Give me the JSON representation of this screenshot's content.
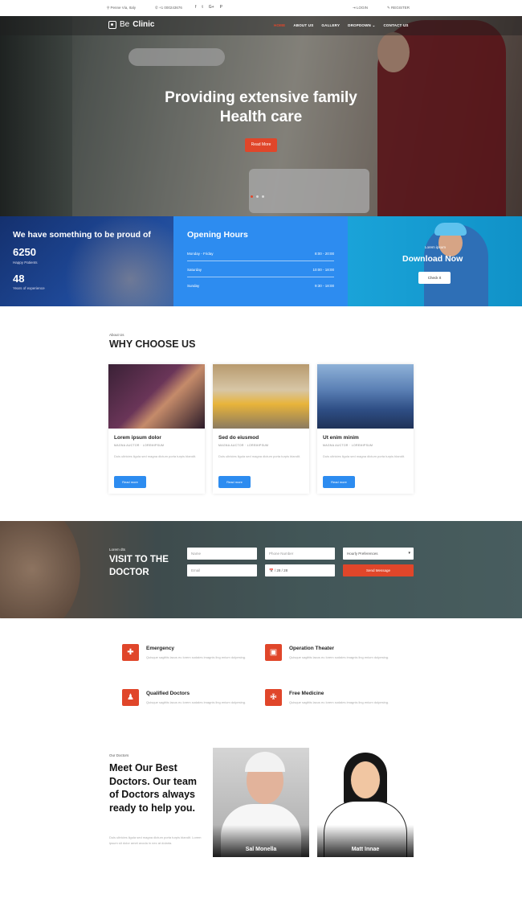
{
  "topbar": {
    "location": "Penne Via, Italy",
    "phone": "+1 000243676",
    "social": [
      "f",
      "t",
      "G+",
      "P"
    ],
    "login": "LOGIN",
    "register": "REGISTER"
  },
  "brand": {
    "part1": "Be",
    "part2": "Clinic"
  },
  "nav": [
    "HOME",
    "ABOUT US",
    "GALLERY",
    "DROPDOWN ⌄",
    "CONTACT US"
  ],
  "hero": {
    "title_line1": "Providing extensive family",
    "title_line2": "Health care",
    "button": "Read More"
  },
  "proud": {
    "title": "We have something to be proud of",
    "stat1_value": "6250",
    "stat1_label": "Happy Patients",
    "stat2_value": "48",
    "stat2_label": "Years of experience"
  },
  "hours": {
    "title": "Opening Hours",
    "rows": [
      {
        "day": "Monday - Friday",
        "time": "8:00 - 20:00"
      },
      {
        "day": "Saturday",
        "time": "10:00 - 18:00"
      },
      {
        "day": "Sunday",
        "time": "9:30 - 18:00"
      }
    ]
  },
  "download": {
    "small": "Lorem ipsum",
    "title": "Download Now",
    "button": "Check It"
  },
  "why": {
    "label": "About Us",
    "title": "WHY CHOOSE US",
    "cards": [
      {
        "title": "Lorem ipsum dolor",
        "meta": "MAGNA AUCTOR · LOREMIPSUM",
        "text": "Duis ultricies ligula sed magna dictum porta turpis blandit.",
        "button": "Read more"
      },
      {
        "title": "Sed do eiusmod",
        "meta": "MAGNA AUCTOR · LOREMIPSUM",
        "text": "Duis ultricies ligula sed magna dictum porta turpis blandit.",
        "button": "Read more"
      },
      {
        "title": "Ut enim minim",
        "meta": "MAGNA AUCTOR · LOREMIPSUM",
        "text": "Duis ultricies ligula sed magna dictum porta turpis blandit.",
        "button": "Read more"
      }
    ]
  },
  "appointment": {
    "label": "Lorem dts",
    "title": "VISIT TO THE DOCTOR",
    "name_placeholder": "Name",
    "phone_placeholder": "Phone Number",
    "preference": "Hourly Preferences",
    "email_placeholder": "Email",
    "date_placeholder": "📅 / 28 / 28",
    "send": "Send Message"
  },
  "features": [
    {
      "icon": "ambulance-icon",
      "glyph": "✚",
      "title": "Emergency",
      "text": "Quisque sagittis lacus eu lorem sodales imagnis ling enium dolpesing."
    },
    {
      "icon": "theater-icon",
      "glyph": "▣",
      "title": "Operation Theater",
      "text": "Quisque sagittis lacus eu lorem sodales imagnis ling enium dolpesing."
    },
    {
      "icon": "doctor-icon",
      "glyph": "♟",
      "title": "Qualified Doctors",
      "text": "Quisque sagittis lacus eu lorem sodales imagnis ling enium dolpesing."
    },
    {
      "icon": "medicine-icon",
      "glyph": "✙",
      "title": "Free Medicine",
      "text": "Quisque sagittis lacus eu lorem sodales imagnis ling enium dolpesing."
    }
  ],
  "doctors": {
    "label": "Our Doctors",
    "title": "Meet Our Best Doctors. Our team of Doctors always ready to help you.",
    "text": "Duis ultricies ligula sed magna dictum porta turpis blandit. Lorem ipsum sit dolor amet avoda in nec at dolaria.",
    "team": [
      {
        "name": "Sal Monella"
      },
      {
        "name": "Matt Innae"
      }
    ]
  }
}
